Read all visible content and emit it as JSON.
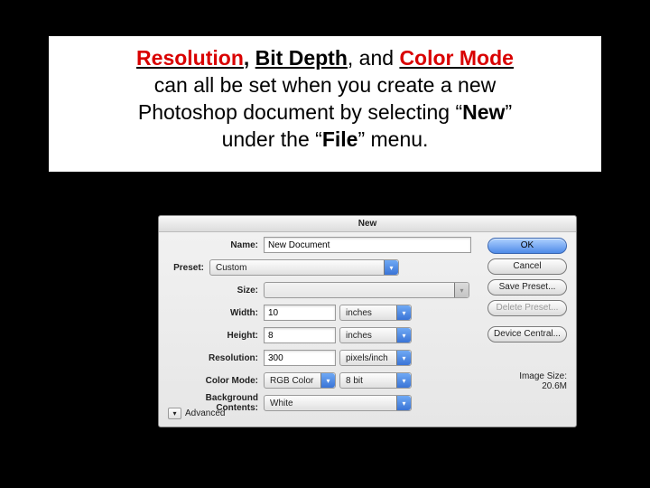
{
  "caption": {
    "l1_a": "Resolution",
    "l1_b": ", ",
    "l1_c": "Bit Depth",
    "l1_d": ", and ",
    "l1_e": "Color Mode",
    "l2": "can all be set when you create a new",
    "l3_a": "Photoshop document by selecting “",
    "l3_b": "New",
    "l3_c": "”",
    "l4_a": "under the “",
    "l4_b": "File",
    "l4_c": "” menu."
  },
  "dialog": {
    "title": "New",
    "labels": {
      "name": "Name:",
      "preset": "Preset:",
      "size": "Size:",
      "width": "Width:",
      "height": "Height:",
      "resolution": "Resolution:",
      "color_mode": "Color Mode:",
      "bg": "Background Contents:",
      "advanced": "Advanced",
      "image_size": "Image Size:"
    },
    "values": {
      "name": "New Document",
      "preset": "Custom",
      "size": "",
      "width": "10",
      "width_unit": "inches",
      "height": "8",
      "height_unit": "inches",
      "resolution": "300",
      "resolution_unit": "pixels/inch",
      "color_mode": "RGB Color",
      "bit_depth": "8 bit",
      "bg": "White",
      "image_size_value": "20.6M"
    },
    "buttons": {
      "ok": "OK",
      "cancel": "Cancel",
      "save_preset": "Save Preset...",
      "delete_preset": "Delete Preset...",
      "device_central": "Device Central..."
    }
  }
}
